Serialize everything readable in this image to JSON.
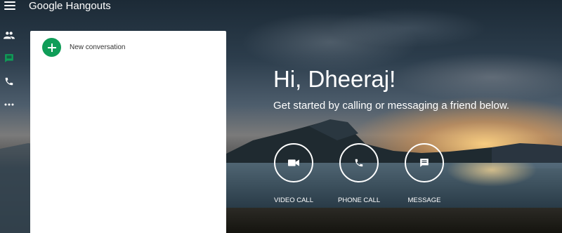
{
  "app": {
    "brand": "Google Hangouts"
  },
  "nav": {
    "items": [
      {
        "icon": "contacts-icon",
        "color": "#ffffff"
      },
      {
        "icon": "message-icon",
        "color": "#0f9d58"
      },
      {
        "icon": "phone-icon",
        "color": "#ffffff"
      },
      {
        "icon": "more-icon",
        "color": "#ffffff"
      }
    ]
  },
  "panel": {
    "new_conversation_label": "New conversation",
    "accent": "#0f9d58"
  },
  "greeting": {
    "title": "Hi, Dheeraj!",
    "subtitle": "Get started by calling or messaging a friend below."
  },
  "actions": [
    {
      "label": "VIDEO CALL",
      "icon": "videocam-icon"
    },
    {
      "label": "PHONE CALL",
      "icon": "phone-icon"
    },
    {
      "label": "MESSAGE",
      "icon": "chat-icon"
    }
  ]
}
